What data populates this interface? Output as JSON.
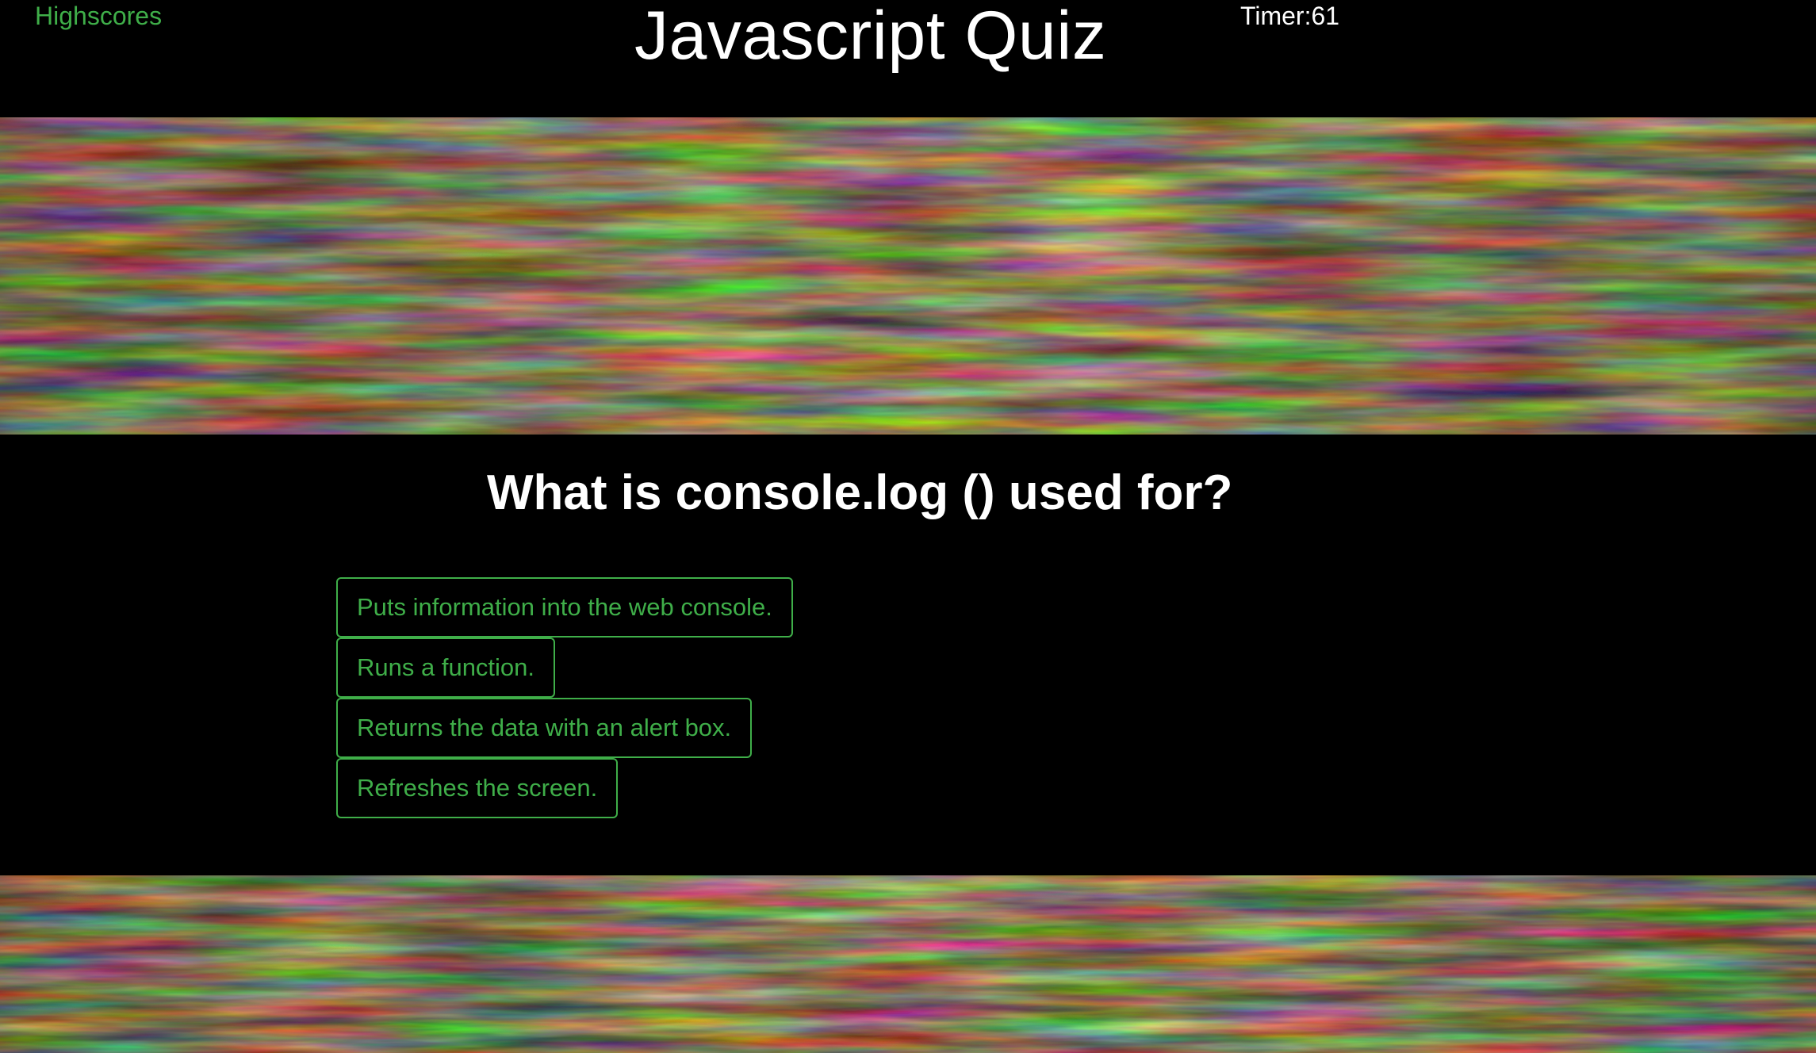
{
  "header": {
    "highscores_label": "Highscores",
    "title": "Javascript Quiz",
    "timer_label": "Timer:",
    "timer_value": "61"
  },
  "quiz": {
    "question": "What is console.log () used for?",
    "answers": [
      "Puts information into the web console.",
      "Runs a function.",
      "Returns the data with an alert box.",
      "Refreshes the screen."
    ]
  },
  "colors": {
    "background": "#000000",
    "accent": "#3fae49",
    "text": "#ffffff"
  }
}
